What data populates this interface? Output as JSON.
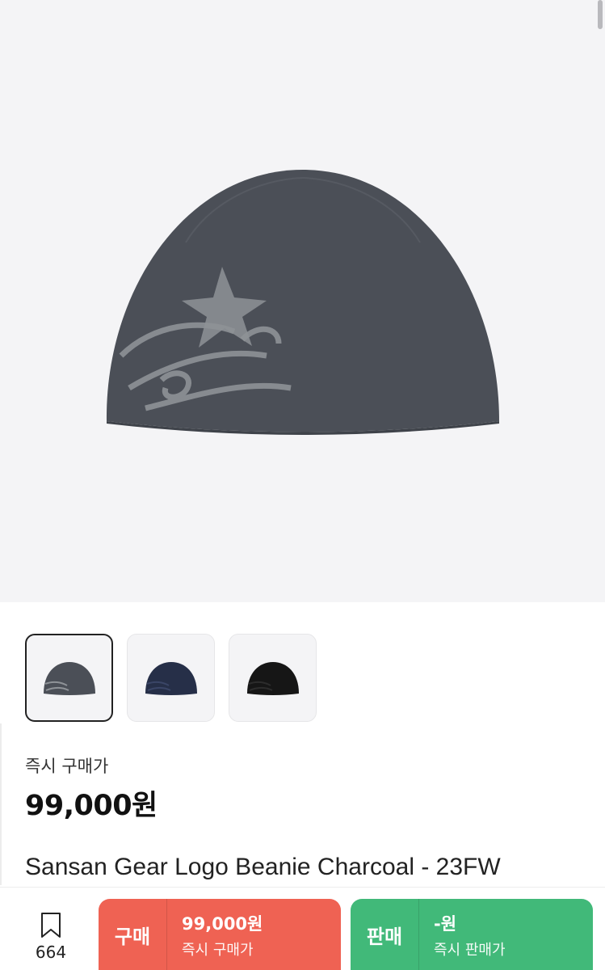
{
  "product": {
    "image_icon": "beanie-icon",
    "thumbnails": [
      {
        "name": "charcoal",
        "color": "#4b4f57",
        "selected": true
      },
      {
        "name": "navy",
        "color": "#262f48",
        "selected": false
      },
      {
        "name": "black",
        "color": "#161616",
        "selected": false
      }
    ],
    "price_label": "즉시 구매가",
    "price": "99,000원",
    "name": "Sansan Gear Logo Beanie Charcoal - 23FW"
  },
  "bottom_bar": {
    "bookmark_icon": "bookmark-icon",
    "bookmark_count": "664",
    "buy": {
      "label": "구매",
      "amount": "99,000원",
      "sub": "즉시 구매가",
      "color": "#ef6253"
    },
    "sell": {
      "label": "판매",
      "amount": "-원",
      "sub": "즉시 판매가",
      "color": "#41b979"
    }
  }
}
